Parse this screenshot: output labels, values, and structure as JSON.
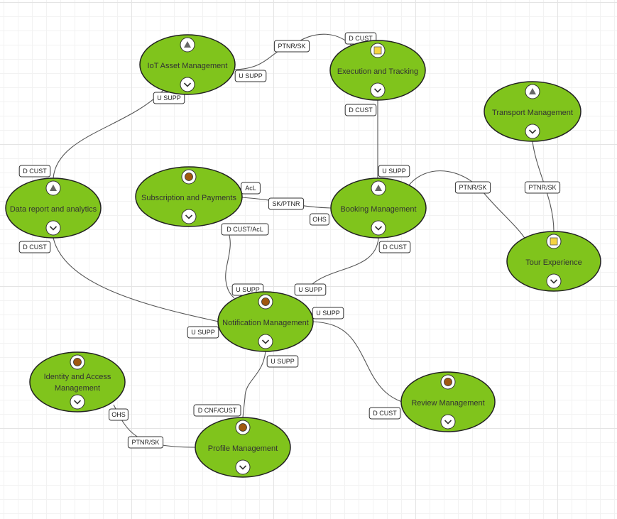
{
  "colors": {
    "node_fill": "#80c41c",
    "node_stroke": "#222222",
    "triangle": "#666666",
    "square": "#f5d442",
    "circle": "#a0580f",
    "edge": "#555555"
  },
  "nodes": [
    {
      "id": "iot",
      "name": "IoT Asset Management",
      "lines": [
        "IoT Asset Management"
      ],
      "top_icon": "triangle-icon"
    },
    {
      "id": "exec",
      "name": "Execution and Tracking",
      "lines": [
        "Execution and Tracking"
      ],
      "top_icon": "square-icon"
    },
    {
      "id": "transport",
      "name": "Transport Management",
      "lines": [
        "Transport Management"
      ],
      "top_icon": "triangle-icon"
    },
    {
      "id": "data",
      "name": "Data report and analytics",
      "lines": [
        "Data report and analytics"
      ],
      "top_icon": "triangle-icon"
    },
    {
      "id": "subs",
      "name": "Subscription and Payments",
      "lines": [
        "Subscription and Payments"
      ],
      "top_icon": "circle-icon"
    },
    {
      "id": "booking",
      "name": "Booking Management",
      "lines": [
        "Booking Management"
      ],
      "top_icon": "triangle-icon"
    },
    {
      "id": "tour",
      "name": "Tour Experience",
      "lines": [
        "Tour Experience"
      ],
      "top_icon": "square-icon"
    },
    {
      "id": "notif",
      "name": "Notification Management",
      "lines": [
        "Notification Management"
      ],
      "top_icon": "circle-icon"
    },
    {
      "id": "identity",
      "name": "Identity and Access Management",
      "lines": [
        "Identity and Access",
        "Management"
      ],
      "top_icon": "circle-icon"
    },
    {
      "id": "review",
      "name": "Review Management",
      "lines": [
        "Review Management"
      ],
      "top_icon": "circle-icon"
    },
    {
      "id": "profile",
      "name": "Profile Management",
      "lines": [
        "Profile Management"
      ],
      "top_icon": "circle-icon"
    }
  ],
  "edges": [
    {
      "from": "iot",
      "to": "exec",
      "labels": [
        "PTNR/SK",
        "U SUPP",
        "D CUST"
      ]
    },
    {
      "from": "iot",
      "to": "data",
      "labels": [
        "U SUPP",
        "D CUST"
      ]
    },
    {
      "from": "exec",
      "to": "booking",
      "labels": [
        "D CUST",
        "U SUPP"
      ]
    },
    {
      "from": "subs",
      "to": "booking",
      "labels": [
        "AcL",
        "SK/PTNR",
        "OHS"
      ]
    },
    {
      "from": "booking",
      "to": "tour",
      "labels": [
        "PTNR/SK"
      ]
    },
    {
      "from": "transport",
      "to": "tour",
      "labels": [
        "PTNR/SK"
      ]
    },
    {
      "from": "subs",
      "to": "notif",
      "labels": [
        "D CUST/AcL",
        "U SUPP"
      ]
    },
    {
      "from": "booking",
      "to": "notif",
      "labels": [
        "D CUST",
        "U SUPP"
      ]
    },
    {
      "from": "data",
      "to": "notif",
      "labels": [
        "D CUST",
        "U SUPP"
      ]
    },
    {
      "from": "notif",
      "to": "review",
      "labels": [
        "U SUPP",
        "D CUST"
      ]
    },
    {
      "from": "notif",
      "to": "profile",
      "labels": [
        "U SUPP",
        "D CNF/CUST"
      ]
    },
    {
      "from": "identity",
      "to": "profile",
      "labels": [
        "OHS",
        "PTNR/SK"
      ]
    }
  ]
}
